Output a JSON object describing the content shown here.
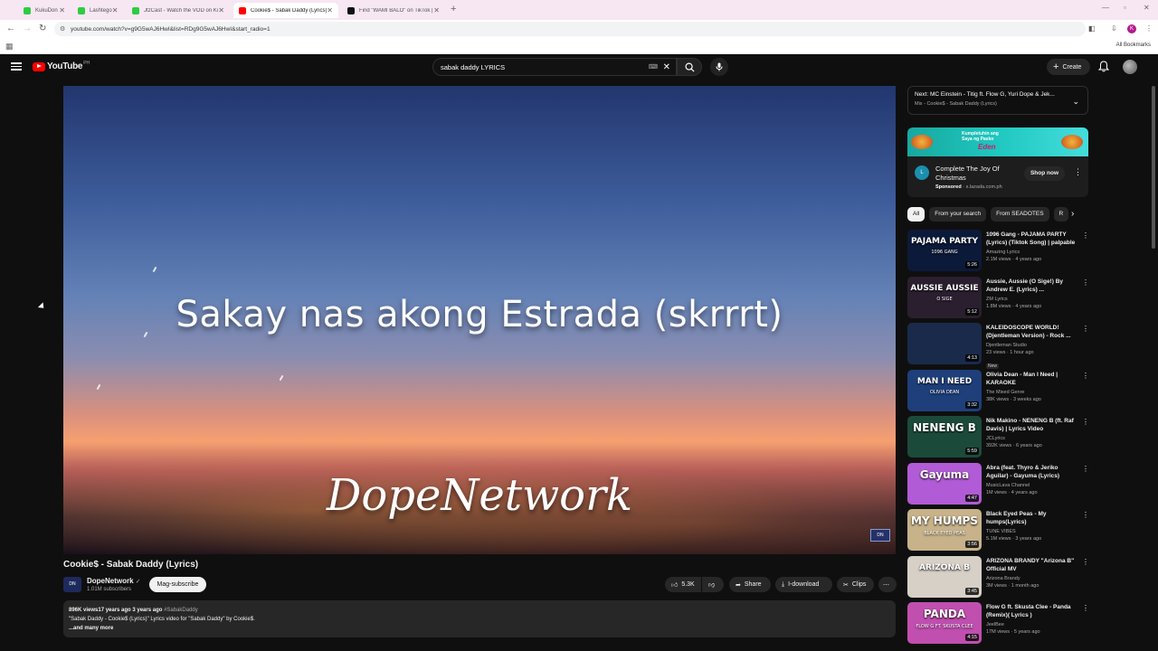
{
  "browser": {
    "tabs": [
      {
        "title": "KukuDon",
        "color": "#2ecc40"
      },
      {
        "title": "Lashtego",
        "color": "#2ecc40"
      },
      {
        "title": "JtzCast - Watch the VOD on Ki",
        "color": "#2ecc40"
      },
      {
        "title": "Cookie$ - Sabak Daddy (Lyrics)",
        "color": "#ff0000"
      },
      {
        "title": "Find \"WAMI BALO\" on TikTok |",
        "color": "#111111"
      }
    ],
    "url": "youtube.com/watch?v=g9G5wAJ6HwI&list=RDg9G5wAJ6HwI&start_radio=1",
    "profile_initial": "K",
    "all_bookmarks": "All Bookmarks"
  },
  "header": {
    "logo_text": "YouTube",
    "country": "PH",
    "search_value": "sabak daddy LYRICS",
    "create_label": "Create"
  },
  "player": {
    "lyric": "Sakay nas akong Estrada (skrrrt)",
    "watermark": "DopeNetwork"
  },
  "video": {
    "title": "Cookie$ - Sabak Daddy (Lyrics)",
    "channel": "DopeNetwork",
    "subscribers": "1.01M subscribers",
    "subscribe_label": "Mag-subscribe",
    "likes": "5.3K",
    "share_label": "Share",
    "download_label": "I-download",
    "clips_label": "Clips",
    "views_date": "896K views17 years ago  3 years ago",
    "hashtag": "#SabakDaddy",
    "description": "\"Sabak Daddy - Cookie$ (Lyrics)\" Lyrics video for \"Sabak Daddy\" by Cookie$.",
    "more_label": "...and many more"
  },
  "sidebar": {
    "next_title": "Next: MC Einstein - Titig ft. Flow G, Yuri Dope & Jek...",
    "next_sub": "Mix - Cookie$ - Sabak Daddy (Lyrics)",
    "ad": {
      "banner_line1": "Kumpletuhin ang",
      "banner_line2": "Saya ng Pasko",
      "banner_brand": "Eden",
      "title": "Complete The Joy Of Christmas",
      "sponsored": "Sponsored",
      "domain": "s.lazada.com.ph",
      "cta": "Shop now"
    },
    "chips": [
      "All",
      "From your search",
      "From SEADOTES",
      "R"
    ],
    "videos": [
      {
        "title": "1096 Gang - PAJAMA PARTY (Lyrics) (Tiktok Song) | palpable",
        "channel": "Amazing Lyrics",
        "meta": "2.1M views · 4 years ago",
        "duration": "5:26",
        "thumb_text": "PAJAMA PARTY",
        "thumb_sub": "1096 GANG",
        "bg": "#0c1a3a"
      },
      {
        "title": "Aussie, Aussie (O Sige!) By Andrew E. (Lyrics) ...",
        "channel": "ZM Lyrics",
        "meta": "1.8M views · 4 years ago",
        "duration": "5:12",
        "thumb_text": "AUSSIE AUSSIE",
        "thumb_sub": "O SIGE",
        "bg": "#2a1f2e"
      },
      {
        "title": "KALEIDOSCOPE WORLD! (Djentleman Version) - Rock ...",
        "channel": "Djentleman Studio",
        "meta": "23 views · 1 hour ago",
        "badge": "New",
        "duration": "4:13",
        "thumb_text": "",
        "thumb_sub": "",
        "bg": "#1a2a4a"
      },
      {
        "title": "Olivia Dean - Man I Need | KARAOKE",
        "channel": "The Mixed Genre",
        "meta": "38K views · 3 weeks ago",
        "duration": "3:32",
        "thumb_text": "MAN I NEED",
        "thumb_sub": "OLIVIA DEAN",
        "bg": "#1e3f7a"
      },
      {
        "title": "Nik Makino - NENENG B (ft. Raf Davis) | Lyrics Video",
        "channel": "JCLyrics",
        "meta": "392K views · 6 years ago",
        "duration": "5:59",
        "thumb_text": "NENENG B",
        "thumb_sub": "",
        "bg": "#1c4a3a"
      },
      {
        "title": "Abra (feat. Thyro & Jeriko Aguilar) - Gayuma (Lyrics)",
        "channel": "MusicLava Channel",
        "meta": "1M views · 4 years ago",
        "duration": "4:47",
        "thumb_text": "Gayuma",
        "thumb_sub": "",
        "bg": "#b25bd6"
      },
      {
        "title": "Black Eyed Peas - My humps(Lyrics)",
        "channel": "TUNE VIBES",
        "meta": "5.1M views · 3 years ago",
        "duration": "3:56",
        "thumb_text": "MY HUMPS",
        "thumb_sub": "BLACK EYED PEAS",
        "bg": "#c7b28a"
      },
      {
        "title": "ARIZONA BRANDY \"Arizona B\" Official MV",
        "channel": "Arizona Brandy",
        "meta": "3M views · 1 month ago",
        "duration": "3:45",
        "thumb_text": "ARIZONA B",
        "thumb_sub": "",
        "bg": "#d7d0c6"
      },
      {
        "title": "Flow G ft. Skusta Clee - Panda (Remix)( Lyrics )",
        "channel": "JeelBee",
        "meta": "17M views · 5 years ago",
        "duration": "4:15",
        "thumb_text": "PANDA",
        "thumb_sub": "FLOW G FT. SKUSTA CLEE",
        "bg": "#c04fb0"
      }
    ]
  }
}
